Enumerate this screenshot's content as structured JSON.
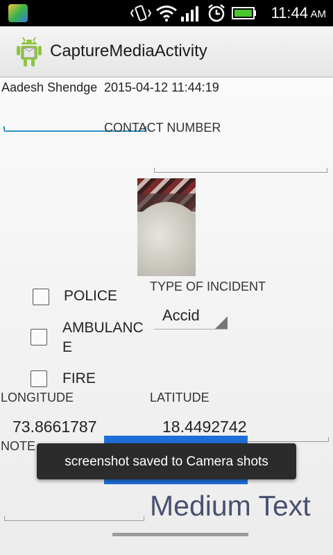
{
  "status_bar": {
    "time": "11:44",
    "ampm": "AM"
  },
  "action_bar": {
    "title": "CaptureMediaActivity"
  },
  "form": {
    "user_name": "Aadesh Shendge",
    "timestamp": "2015-04-12 11:44:19",
    "contact_number_label": "CONTACT NUMBER",
    "type_of_incident_label": "TYPE OF INCIDENT",
    "incident_spinner_value": "Accid",
    "checkboxes": {
      "police": "POLICE",
      "ambulance_line1": "AMBULANC",
      "ambulance_line2": "E",
      "fire": "FIRE"
    },
    "longitude_label": "LONGITUDE",
    "latitude_label": "LATITUDE",
    "longitude_value": "73.8661787",
    "latitude_value": "18.4492742",
    "note_label": "NOTE",
    "medium_text": "Medium Text"
  },
  "toast": {
    "message": "screenshot saved to Camera shots"
  },
  "colors": {
    "accent": "#33b5e5",
    "button_blue": "#1e6fd6",
    "toast_bg": "#2b2b2b"
  }
}
